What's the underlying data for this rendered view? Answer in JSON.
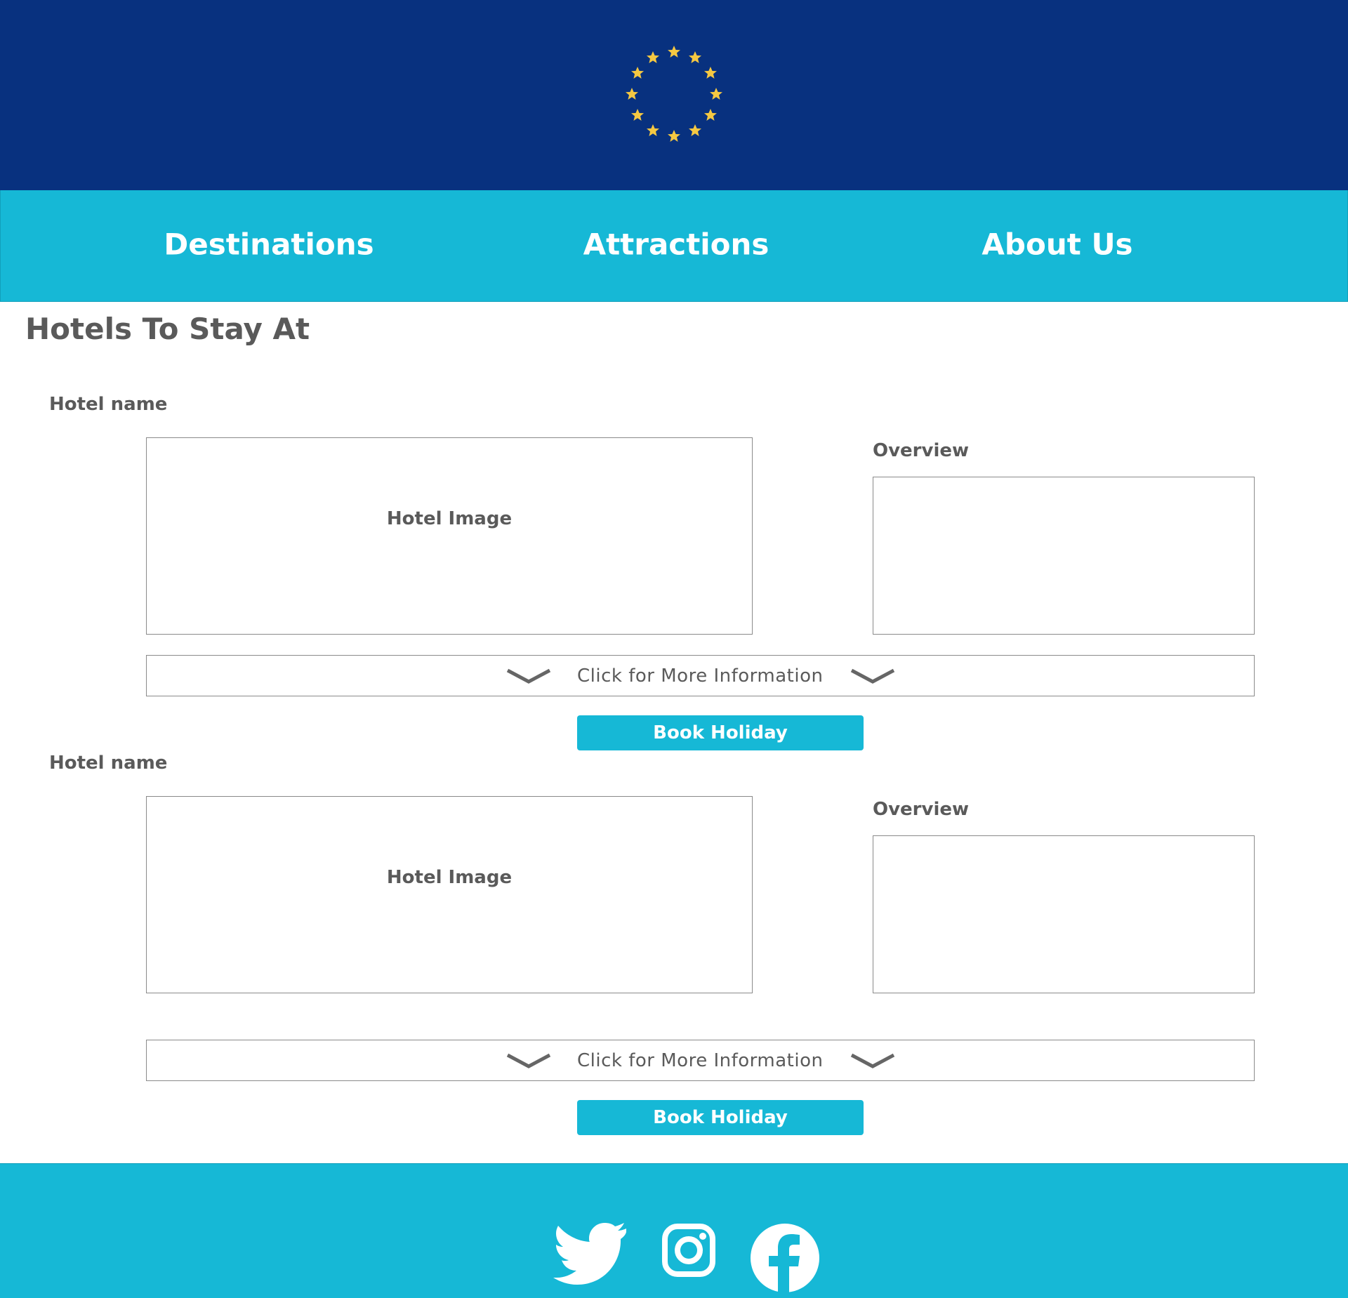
{
  "header": {
    "logo_icon": "eu-stars-icon",
    "background_color": "#08317f",
    "star_color": "#f5c842"
  },
  "nav": {
    "background_color": "#16b8d6",
    "items": [
      {
        "label": "Destinations"
      },
      {
        "label": "Attractions"
      },
      {
        "label": "About Us"
      }
    ]
  },
  "main": {
    "title": "Hotels To Stay At",
    "hotels": [
      {
        "name": "Hotel name",
        "image_label": "Hotel Image",
        "overview_label": "Overview",
        "more_info_label": "Click for More Information",
        "book_label": "Book Holiday"
      },
      {
        "name": "Hotel name",
        "image_label": "Hotel Image",
        "overview_label": "Overview",
        "more_info_label": "Click for More Information",
        "book_label": "Book Holiday"
      }
    ]
  },
  "footer": {
    "social_icons": [
      "twitter-icon",
      "instagram-icon",
      "facebook-icon"
    ],
    "icon_color": "#ffffff"
  }
}
